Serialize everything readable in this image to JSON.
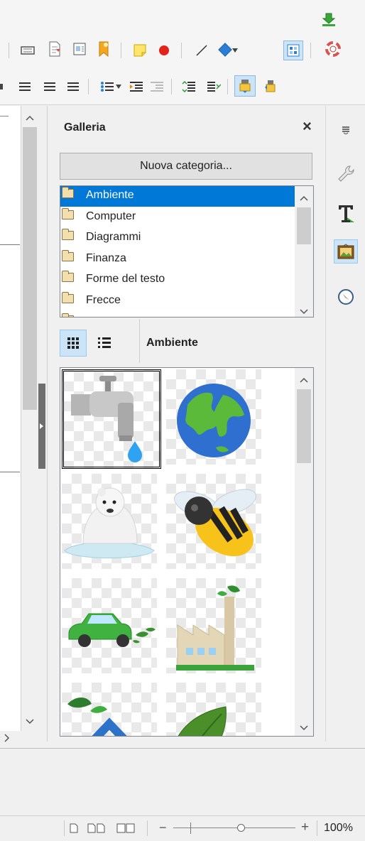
{
  "gallery": {
    "title": "Galleria",
    "close_symbol": "×",
    "new_category_label": "Nuova categoria...",
    "categories": [
      {
        "label": "Ambiente",
        "selected": true
      },
      {
        "label": "Computer"
      },
      {
        "label": "Diagrammi"
      },
      {
        "label": "Finanza"
      },
      {
        "label": "Forme del testo"
      },
      {
        "label": "Frecce"
      }
    ],
    "current_theme": "Ambiente",
    "view_modes": [
      "icon-view",
      "detailed-view"
    ],
    "items": [
      "faucet",
      "globe",
      "polar-bear",
      "bee",
      "car",
      "factory",
      "house",
      "leaf"
    ]
  },
  "statusbar": {
    "zoom_minus": "−",
    "zoom_plus": "+",
    "zoom_percent": "100%"
  },
  "colors": {
    "selection": "#0078d7",
    "selected_item_bg": "#cce4f7",
    "panel_bg": "#f0f0f0"
  }
}
